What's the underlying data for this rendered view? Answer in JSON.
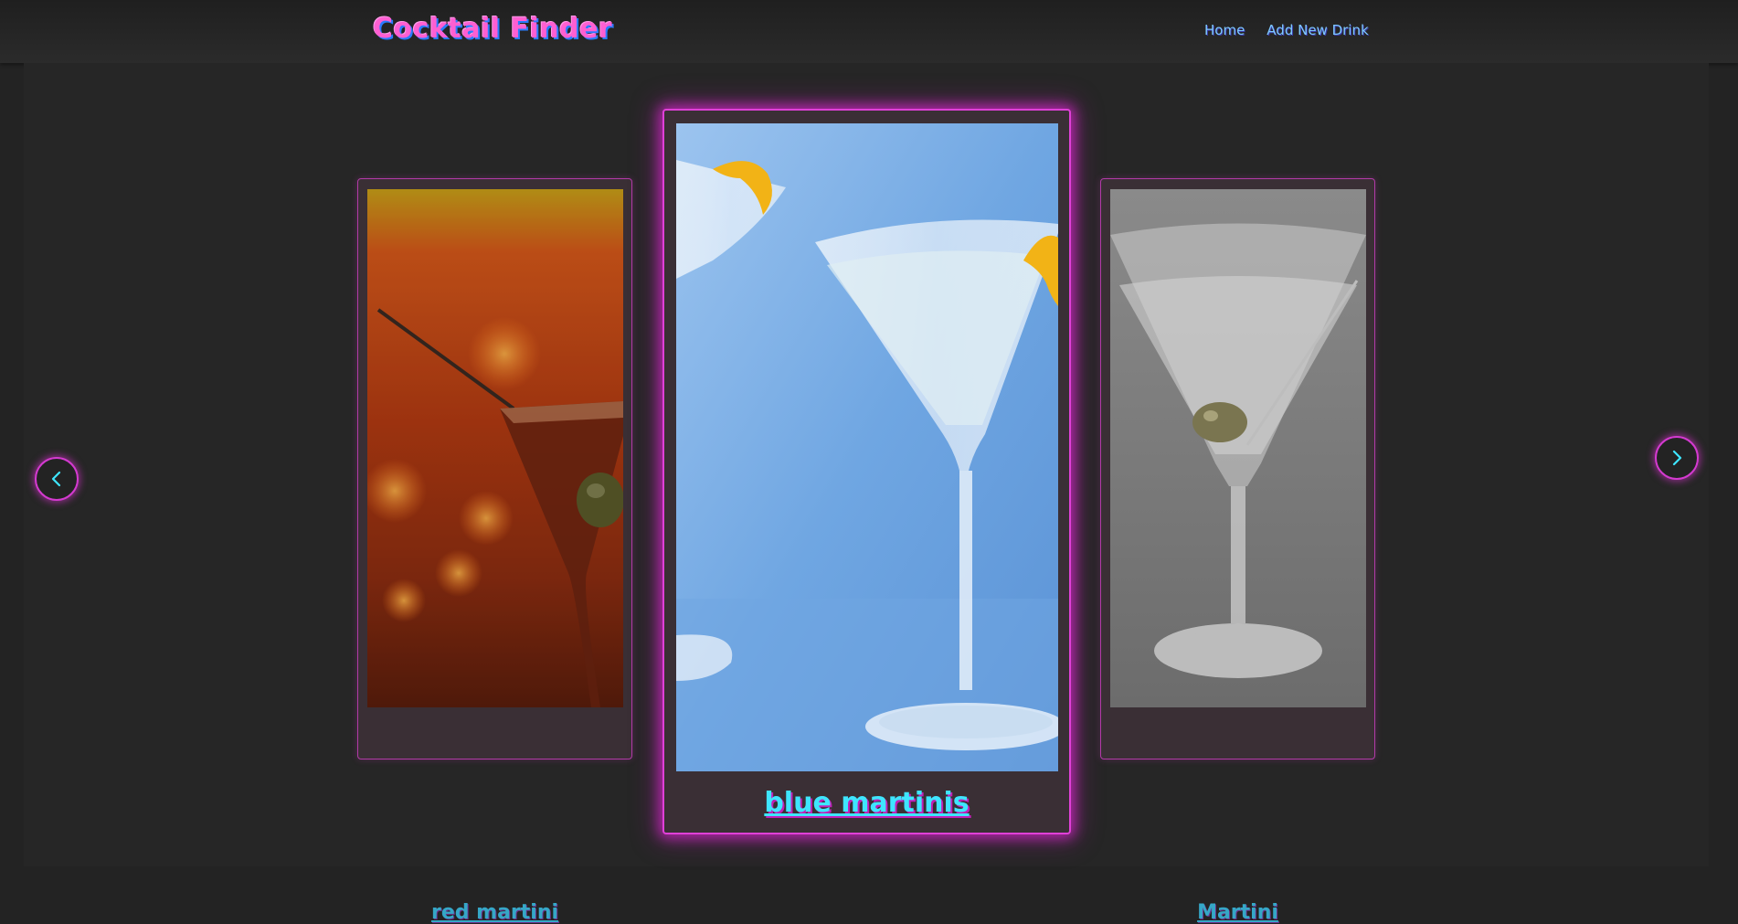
{
  "header": {
    "brand": "Cocktail Finder",
    "nav": [
      {
        "label": "Home"
      },
      {
        "label": "Add New Drink"
      }
    ]
  },
  "carousel": {
    "prev_icon": "chevron-left-icon",
    "next_icon": "chevron-right-icon",
    "cards": [
      {
        "name": "red martini",
        "position": "left"
      },
      {
        "name": "blue martinis",
        "position": "center",
        "active": true
      },
      {
        "name": "Martini",
        "position": "right"
      }
    ]
  },
  "colors": {
    "background": "#232323",
    "accent_pink": "#e040d8",
    "accent_cyan": "#3ee6ff",
    "brand_pink": "#ff5fd2",
    "nav_link": "#7ec8ff"
  }
}
